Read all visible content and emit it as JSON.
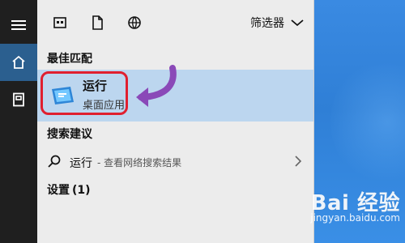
{
  "toolbar": {
    "icons": [
      "apps-icon",
      "document-icon",
      "web-icon"
    ],
    "filter_label": "筛选器"
  },
  "sections": {
    "best_match_title": "最佳匹配",
    "search_suggestions_title": "搜索建议",
    "settings_title": "设置",
    "settings_count": "(1)"
  },
  "best_match": {
    "name": "运行",
    "subtitle": "桌面应用"
  },
  "suggestion": {
    "text": "运行",
    "detail": "- 查看网络搜索结果"
  },
  "watermark": {
    "logo_text": "Bai 经验",
    "url_text": "jingyan.baidu.com"
  },
  "colors": {
    "rail_bg": "#1f1f1f",
    "rail_active_bg": "#2b5f8f",
    "panel_bg": "#ececec",
    "best_match_bg": "#bcd6ef",
    "highlight_border": "#e01f2f",
    "annotation_arrow": "#8a49b8",
    "desktop_bg": "#2f7fd6"
  }
}
